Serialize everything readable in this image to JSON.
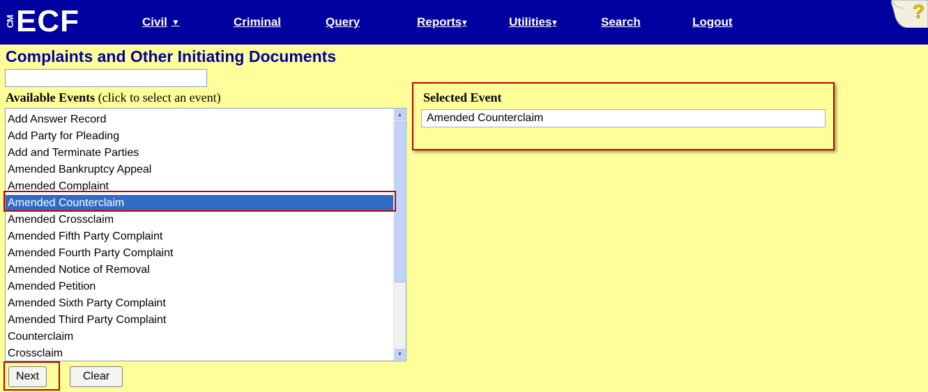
{
  "app": {
    "logo_text": "ECF",
    "logo_prefix": "CM"
  },
  "nav": {
    "items": [
      {
        "label": "Civil",
        "dropdown": true
      },
      {
        "label": "Criminal",
        "dropdown": false
      },
      {
        "label": "Query",
        "dropdown": false
      },
      {
        "label": "Reports",
        "dropdown": true
      },
      {
        "label": "Utilities",
        "dropdown": true
      },
      {
        "label": "Search",
        "dropdown": false
      },
      {
        "label": "Logout",
        "dropdown": false
      }
    ],
    "help_icon": "help-question-icon"
  },
  "page": {
    "title": "Complaints and Other Initiating Documents"
  },
  "filter": {
    "value": ""
  },
  "available": {
    "label_bold": "Available Events",
    "label_hint": "(click to select an event)",
    "items": [
      "Add Answer Record",
      "Add Party for Pleading",
      "Add and Terminate Parties",
      "Amended Bankruptcy Appeal",
      "Amended Complaint",
      "Amended Counterclaim",
      "Amended Crossclaim",
      "Amended Fifth Party Complaint",
      "Amended Fourth Party Complaint",
      "Amended Notice of Removal",
      "Amended Petition",
      "Amended Sixth Party Complaint",
      "Amended Third Party Complaint",
      "Counterclaim",
      "Crossclaim"
    ],
    "selected_index": 5
  },
  "selected": {
    "label": "Selected Event",
    "value": "Amended Counterclaim"
  },
  "buttons": {
    "next": "Next",
    "clear": "Clear"
  },
  "colors": {
    "nav_bg": "#0000a0",
    "page_bg": "#ffff99",
    "highlight": "#c00000",
    "selection": "#316ac5"
  }
}
